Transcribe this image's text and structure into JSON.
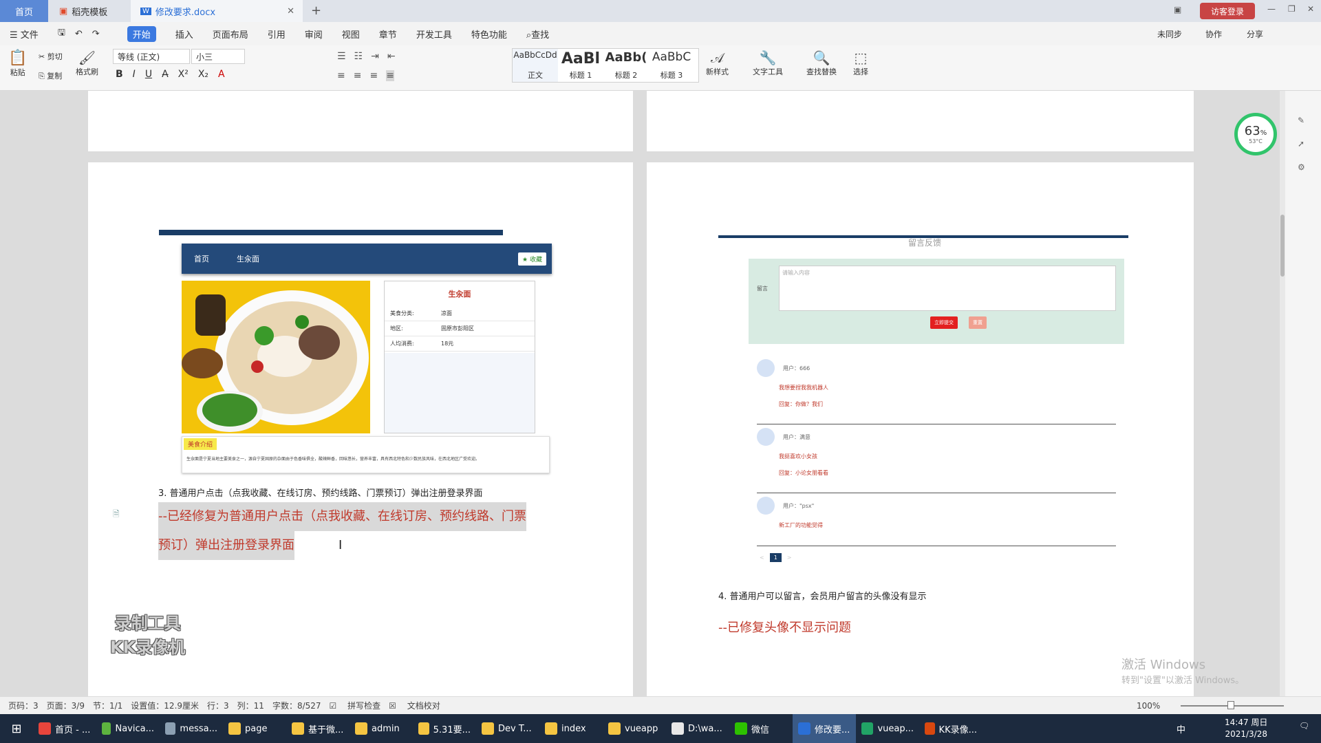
{
  "titlebar": {
    "tab_home": "首页",
    "tab_template": "稻壳模板",
    "tab_doc": "修改要求.docx",
    "login": "访客登录"
  },
  "menu": {
    "file": "文件",
    "items": [
      "开始",
      "插入",
      "页面布局",
      "引用",
      "审阅",
      "视图",
      "章节",
      "开发工具",
      "特色功能"
    ],
    "search": "查找",
    "right": [
      "未同步",
      "协作",
      "分享"
    ]
  },
  "ribbon": {
    "paste": "粘贴",
    "cut": "剪切",
    "copy": "复制",
    "format_painter": "格式刷",
    "font": "等线 (正文)",
    "size": "小三",
    "styles": [
      {
        "preview": "AaBbCcDd",
        "name": "正文"
      },
      {
        "preview": "AaBl",
        "name": "标题 1"
      },
      {
        "preview": "AaBb(",
        "name": "标题 2"
      },
      {
        "preview": "AaBbC",
        "name": "标题 3"
      }
    ],
    "new_style": "新样式",
    "text_tool": "文字工具",
    "find_replace": "查找替换",
    "select": "选择"
  },
  "left_page": {
    "web_nav": [
      "首页",
      "生汆面"
    ],
    "collect_button": "收藏",
    "food_title": "生汆面",
    "info_rows": [
      {
        "k": "美食分类:",
        "v": "凉面"
      },
      {
        "k": "地区:",
        "v": "固原市彭阳区"
      },
      {
        "k": "人均消费:",
        "v": "18元"
      }
    ],
    "intro_label": "美食介绍",
    "intro_text": "生汆面是宁夏当地主要美食之一，源自宁夏固原的杂面由于色香味俱全，酸辣鲜香，回味悠长，营养丰富，具有西北特色和少数民族风味，在西北地区广受欢迎。",
    "item3": "3.  普通用户点击（点我收藏、在线订房、预约线路、门票预订）弹出注册登录界面",
    "fix3_line1": "--已经修复为普通用户点击（点我收藏、在线订房、预约线路、门票",
    "fix3_line2": "预订）弹出注册登录界面",
    "watermark_l1": "录制工具",
    "watermark_l2": "KK录像机"
  },
  "right_page": {
    "section_title": "留言反馈",
    "msg_label": "留言",
    "msg_placeholder": "请输入内容",
    "submit": "立即提交",
    "reset": "重置",
    "comments": [
      {
        "user": "用户：666",
        "content": "我想要捏我我机器人",
        "reply": "回复：你做？我们"
      },
      {
        "user": "用户：满意",
        "content": "我挺喜欢小女孩",
        "reply": "回复：小论女朋看看"
      },
      {
        "user": "用户：\"psx\"",
        "content": "新工厂的功能觉得",
        "reply": ""
      }
    ],
    "pagination": [
      "<",
      "1",
      ">"
    ],
    "item4": "4.  普通用户可以留言，会员用户留言的头像没有显示",
    "fix4": "--已修复头像不显示问题",
    "activate1": "激活 Windows",
    "activate2": "转到\"设置\"以激活 Windows。"
  },
  "perf": {
    "percent": "63",
    "unit": "%",
    "temp": "53°C"
  },
  "status": {
    "items": [
      "页码：3",
      "页面：3/9",
      "节：1/1",
      "设置值：12.9厘米",
      "行：3",
      "列：11",
      "字数：8/527",
      "拼写检查",
      "文档校对"
    ],
    "zoom": "100%"
  },
  "taskbar": {
    "items": [
      {
        "label": "首页 - ...",
        "color": "#e8453c"
      },
      {
        "label": "Navica...",
        "color": "#5db33f"
      },
      {
        "label": "messa...",
        "color": "#8ca0b3"
      },
      {
        "label": "page",
        "color": "#f5c542"
      },
      {
        "label": "基于微...",
        "color": "#f5c542"
      },
      {
        "label": "admin",
        "color": "#f5c542"
      },
      {
        "label": "5.31要...",
        "color": "#f5c542"
      },
      {
        "label": "Dev T...",
        "color": "#f5c542"
      },
      {
        "label": "index",
        "color": "#f5c542"
      },
      {
        "label": "vueapp",
        "color": "#f5c542"
      },
      {
        "label": "D:\\wa...",
        "color": "#e8e8e8"
      },
      {
        "label": "微信",
        "color": "#2dc100"
      },
      {
        "label": "修改要...",
        "color": "#2b6fd6"
      },
      {
        "label": "vueap...",
        "color": "#21a366"
      },
      {
        "label": "KK录像...",
        "color": "#d9480f"
      }
    ],
    "time": "14:47 周日",
    "date": "2021/3/28",
    "ime": "中"
  }
}
